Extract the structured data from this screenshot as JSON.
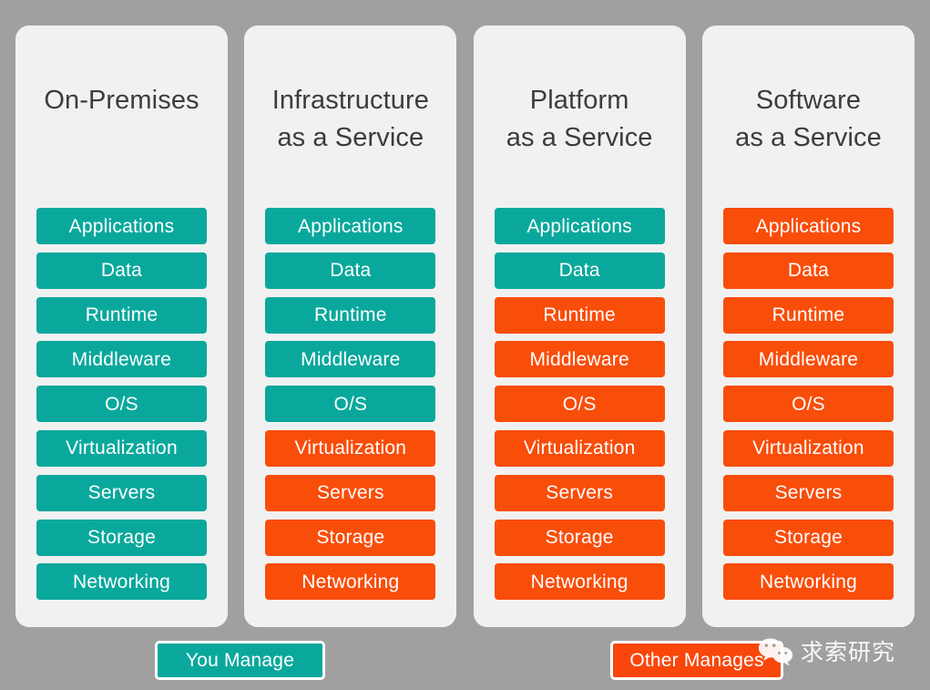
{
  "background_color": "#a0a0a0",
  "colors": {
    "you_manage": "#0aa89c",
    "other_manages": "#f94d0a",
    "card_background": "#f1f1f1",
    "title_text": "#3c3c3c",
    "layer_text": "#ffffff"
  },
  "columns": [
    {
      "id": "on-premises",
      "title": "On-Premises",
      "layers": [
        {
          "label": "Applications",
          "managed_by": "you"
        },
        {
          "label": "Data",
          "managed_by": "you"
        },
        {
          "label": "Runtime",
          "managed_by": "you"
        },
        {
          "label": "Middleware",
          "managed_by": "you"
        },
        {
          "label": "O/S",
          "managed_by": "you"
        },
        {
          "label": "Virtualization",
          "managed_by": "you"
        },
        {
          "label": "Servers",
          "managed_by": "you"
        },
        {
          "label": "Storage",
          "managed_by": "you"
        },
        {
          "label": "Networking",
          "managed_by": "you"
        }
      ]
    },
    {
      "id": "infrastructure-as-a-service",
      "title": "Infrastructure\nas a Service",
      "layers": [
        {
          "label": "Applications",
          "managed_by": "you"
        },
        {
          "label": "Data",
          "managed_by": "you"
        },
        {
          "label": "Runtime",
          "managed_by": "you"
        },
        {
          "label": "Middleware",
          "managed_by": "you"
        },
        {
          "label": "O/S",
          "managed_by": "you"
        },
        {
          "label": "Virtualization",
          "managed_by": "other"
        },
        {
          "label": "Servers",
          "managed_by": "other"
        },
        {
          "label": "Storage",
          "managed_by": "other"
        },
        {
          "label": "Networking",
          "managed_by": "other"
        }
      ]
    },
    {
      "id": "platform-as-a-service",
      "title": "Platform\nas a Service",
      "layers": [
        {
          "label": "Applications",
          "managed_by": "you"
        },
        {
          "label": "Data",
          "managed_by": "you"
        },
        {
          "label": "Runtime",
          "managed_by": "other"
        },
        {
          "label": "Middleware",
          "managed_by": "other"
        },
        {
          "label": "O/S",
          "managed_by": "other"
        },
        {
          "label": "Virtualization",
          "managed_by": "other"
        },
        {
          "label": "Servers",
          "managed_by": "other"
        },
        {
          "label": "Storage",
          "managed_by": "other"
        },
        {
          "label": "Networking",
          "managed_by": "other"
        }
      ]
    },
    {
      "id": "software-as-a-service",
      "title": "Software\nas a Service",
      "layers": [
        {
          "label": "Applications",
          "managed_by": "other"
        },
        {
          "label": "Data",
          "managed_by": "other"
        },
        {
          "label": "Runtime",
          "managed_by": "other"
        },
        {
          "label": "Middleware",
          "managed_by": "other"
        },
        {
          "label": "O/S",
          "managed_by": "other"
        },
        {
          "label": "Virtualization",
          "managed_by": "other"
        },
        {
          "label": "Servers",
          "managed_by": "other"
        },
        {
          "label": "Storage",
          "managed_by": "other"
        },
        {
          "label": "Networking",
          "managed_by": "other"
        }
      ]
    }
  ],
  "legend": {
    "you_manage": "You Manage",
    "other_manages": "Other Manages"
  },
  "watermark": {
    "icon": "wechat-icon",
    "text": "求索研究"
  }
}
